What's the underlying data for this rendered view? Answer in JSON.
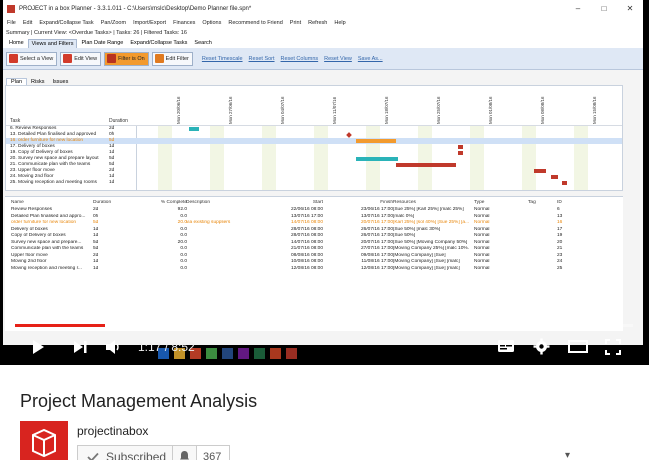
{
  "window": {
    "title": "PROJECT in a box Planner - 3.3.1.011 - C:\\Users\\mslc\\Desktop\\Demo Planner file.spn*"
  },
  "menu": [
    "File",
    "Edit",
    "Expand/Collapse Task",
    "Pan/Zoom",
    "Import/Export",
    "Finances",
    "Options",
    "Recommend to Friend",
    "Print",
    "Refresh",
    "Help"
  ],
  "summary": "Summary | Current View: <Overdue Tasks> | Tasks: 26 | Filtered Tasks: 16",
  "ribbon_tabs": [
    "Home",
    "Views and Filters",
    "Plan Date Range",
    "Expand/Collapse Tasks",
    "Search"
  ],
  "toolbar": {
    "buttons": [
      "Select a View",
      "Edit View",
      "Filter is On",
      "Edit Filter"
    ],
    "links": [
      "Reset Timescale",
      "Reset Sort",
      "Reset Columns",
      "Reset View",
      "Save As..."
    ]
  },
  "view_tabs": [
    "Plan",
    "Risks",
    "Issues"
  ],
  "gantt": {
    "headers": {
      "task": "Task",
      "duration": "Duration"
    },
    "dates": [
      "Mon 20/06/16",
      "Mon 27/06/16",
      "Mon 04/07/16",
      "Mon 11/07/16",
      "Mon 18/07/16",
      "Mon 25/07/16",
      "Mon 01/08/16",
      "Mon 08/08/16",
      "Mon 15/08/16"
    ],
    "rows": [
      {
        "task": "6. Review Responses",
        "duration": "2d"
      },
      {
        "task": "13. Detailed Plan finalised and approved",
        "duration": "0h"
      },
      {
        "task": "16. order furniture for new location",
        "duration": "5d"
      },
      {
        "task": "17. Delivery of boxes",
        "duration": "1d"
      },
      {
        "task": "19. Copy of Delivery of boxes",
        "duration": "1d"
      },
      {
        "task": "20. Survey new space and prepare layout",
        "duration": "5d"
      },
      {
        "task": "21. Communicate plan with the teams",
        "duration": "5d"
      },
      {
        "task": "23. Upper floor move",
        "duration": "2d"
      },
      {
        "task": "24. Moving 2nd floor",
        "duration": "1d"
      },
      {
        "task": "25. Moving reception and meeting rooms",
        "duration": "1d"
      }
    ]
  },
  "task_table": {
    "headers": [
      "Name",
      "Duration",
      "% Complete",
      "Description",
      "Start",
      "Finish",
      "Resources",
      "Type",
      "Tag",
      "ID"
    ],
    "rows": [
      [
        "Review Responses",
        "2d",
        "92.0",
        "",
        "22/06/16 08:00",
        "23/06/16 17:00",
        "[Sue 25%] [Karl 25%] [malc 25%]",
        "Normal",
        "",
        "6"
      ],
      [
        "Detailed Plan finalised and appro...",
        "0h",
        "0.0",
        "",
        "13/07/16 17:00",
        "13/07/16 17:00",
        "[malc 0%]",
        "Normal",
        "",
        "13"
      ],
      [
        "order furniture for new location",
        "5d",
        "20.0",
        "via existing suppliers",
        "14/07/16 08:00",
        "20/07/16 17:00",
        "[Karl 25%] [sol 40%] [Sue 25%] [a...",
        "Normal",
        "",
        "16"
      ],
      [
        "Delivery of boxes",
        "1d",
        "0.0",
        "",
        "28/07/16 08:00",
        "26/07/16 17:00",
        "[Sue 50%] [malc 30%]",
        "Normal",
        "",
        "17"
      ],
      [
        "Copy of Delivery of boxes",
        "1d",
        "0.0",
        "",
        "28/07/16 08:00",
        "26/07/16 17:00",
        "[Sue 50%]",
        "Normal",
        "",
        "19"
      ],
      [
        "Survey new space and prepare...",
        "5d",
        "20.0",
        "",
        "14/07/16 08:00",
        "20/07/16 17:00",
        "[Sue 50%] [Moving Company 50%]",
        "Normal",
        "",
        "20"
      ],
      [
        "Communicate plan with the teams",
        "5d",
        "0.0",
        "",
        "21/07/16 08:00",
        "27/07/16 17:00",
        "[Moving Company 25%] [malc 10%...",
        "Normal",
        "",
        "21"
      ],
      [
        "Upper floor move",
        "2d",
        "0.0",
        "",
        "08/08/16 08:00",
        "09/08/16 17:00",
        "[Moving Company] [Sue]",
        "Normal",
        "",
        "23"
      ],
      [
        "Moving 2nd floor",
        "1d",
        "0.0",
        "",
        "10/08/16 08:00",
        "11/08/16 17:00",
        "[Moving Company] [Sue] [malc]",
        "Normal",
        "",
        "24"
      ],
      [
        "Moving reception and meeting r...",
        "1d",
        "0.0",
        "",
        "12/08/16 08:00",
        "12/08/16 17:00",
        "[Moving Company] [Sue] [malc]",
        "Normal",
        "",
        "25"
      ]
    ]
  },
  "player": {
    "timecode": "1:17 / 8:52",
    "progress": 0.145
  },
  "video": {
    "title": "Project Management Analysis",
    "channel": "projectinabox",
    "subscribe_label": "Subscribed",
    "subscriber_count": "367"
  },
  "colors": {
    "brand_red": "#d8241f",
    "progress_red": "#e62117",
    "highlight_orange": "#e8860a",
    "gantt_bar_red": "#c0392b",
    "gantt_bar_teal": "#2ab3b8"
  }
}
